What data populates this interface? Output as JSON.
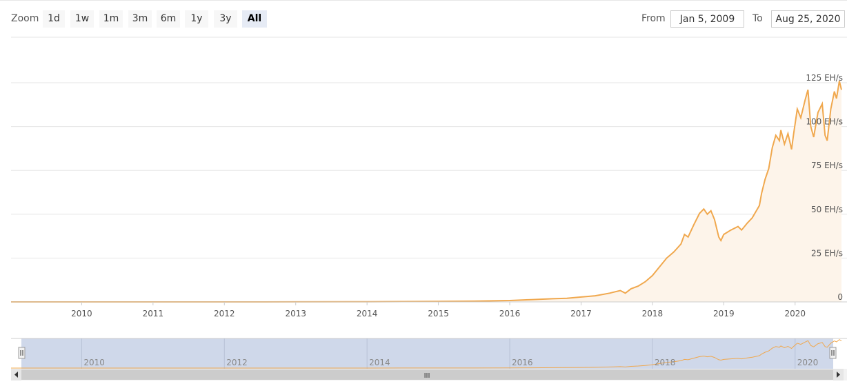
{
  "zoom": {
    "label": "Zoom",
    "buttons": [
      "1d",
      "1w",
      "1m",
      "3m",
      "6m",
      "1y",
      "3y",
      "All"
    ],
    "active": "All"
  },
  "range": {
    "from_label": "From",
    "from_value": "Jan 5, 2009",
    "to_label": "To",
    "to_value": "Aug 25, 2020"
  },
  "colors": {
    "line": "#f0a84e",
    "area": "#fdf4ea",
    "navigator_mask": "#cfd8ea"
  },
  "scrollbar": {
    "grip": "III"
  },
  "chart_data": {
    "type": "area",
    "xlabel": "",
    "ylabel": "",
    "xlim": [
      2009.01,
      2020.65
    ],
    "ylim": [
      0,
      125
    ],
    "yticks": [
      {
        "value": 0,
        "label": "0"
      },
      {
        "value": 25,
        "label": "25 EH/s"
      },
      {
        "value": 50,
        "label": "50 EH/s"
      },
      {
        "value": 75,
        "label": "75 EH/s"
      },
      {
        "value": 100,
        "label": "100 EH/s"
      },
      {
        "value": 125,
        "label": "125 EH/s"
      }
    ],
    "xticks": [
      "2010",
      "2011",
      "2012",
      "2013",
      "2014",
      "2015",
      "2016",
      "2017",
      "2018",
      "2019",
      "2020"
    ],
    "navigator_ticks": [
      "2010",
      "2012",
      "2014",
      "2016",
      "2018",
      "2020"
    ],
    "grid": true,
    "legend": "none",
    "series": [
      {
        "points": [
          [
            2009.01,
            0
          ],
          [
            2010.0,
            0
          ],
          [
            2011.0,
            0
          ],
          [
            2012.0,
            0
          ],
          [
            2013.0,
            0.02
          ],
          [
            2014.0,
            0.1
          ],
          [
            2014.5,
            0.2
          ],
          [
            2015.0,
            0.3
          ],
          [
            2015.5,
            0.45
          ],
          [
            2016.0,
            0.8
          ],
          [
            2016.3,
            1.3
          ],
          [
            2016.6,
            1.8
          ],
          [
            2016.8,
            2.1
          ],
          [
            2017.0,
            2.8
          ],
          [
            2017.2,
            3.5
          ],
          [
            2017.4,
            5.0
          ],
          [
            2017.55,
            6.5
          ],
          [
            2017.62,
            5.0
          ],
          [
            2017.7,
            7.5
          ],
          [
            2017.8,
            9.0
          ],
          [
            2017.9,
            11.5
          ],
          [
            2018.0,
            15.0
          ],
          [
            2018.1,
            20.0
          ],
          [
            2018.2,
            25.0
          ],
          [
            2018.3,
            28.5
          ],
          [
            2018.4,
            33.0
          ],
          [
            2018.45,
            38.5
          ],
          [
            2018.5,
            37.0
          ],
          [
            2018.58,
            44.0
          ],
          [
            2018.66,
            50.5
          ],
          [
            2018.72,
            53.0
          ],
          [
            2018.77,
            50.0
          ],
          [
            2018.82,
            52.0
          ],
          [
            2018.87,
            47.0
          ],
          [
            2018.93,
            37.0
          ],
          [
            2018.96,
            35.0
          ],
          [
            2019.0,
            38.5
          ],
          [
            2019.1,
            41.0
          ],
          [
            2019.2,
            43.0
          ],
          [
            2019.25,
            41.0
          ],
          [
            2019.33,
            45.0
          ],
          [
            2019.4,
            48.0
          ],
          [
            2019.5,
            55.0
          ],
          [
            2019.53,
            62.0
          ],
          [
            2019.58,
            70.0
          ],
          [
            2019.63,
            76.0
          ],
          [
            2019.68,
            88.0
          ],
          [
            2019.73,
            95.0
          ],
          [
            2019.78,
            92.0
          ],
          [
            2019.8,
            98.0
          ],
          [
            2019.85,
            90.0
          ],
          [
            2019.9,
            96.0
          ],
          [
            2019.95,
            87.0
          ],
          [
            2019.98,
            96.0
          ],
          [
            2020.03,
            110.0
          ],
          [
            2020.08,
            105.0
          ],
          [
            2020.14,
            115.0
          ],
          [
            2020.18,
            121.0
          ],
          [
            2020.22,
            100.0
          ],
          [
            2020.26,
            94.0
          ],
          [
            2020.32,
            108.0
          ],
          [
            2020.38,
            113.0
          ],
          [
            2020.42,
            95.0
          ],
          [
            2020.45,
            92.0
          ],
          [
            2020.5,
            110.0
          ],
          [
            2020.55,
            120.0
          ],
          [
            2020.58,
            116.0
          ],
          [
            2020.62,
            126.0
          ],
          [
            2020.65,
            121.0
          ]
        ]
      }
    ]
  }
}
